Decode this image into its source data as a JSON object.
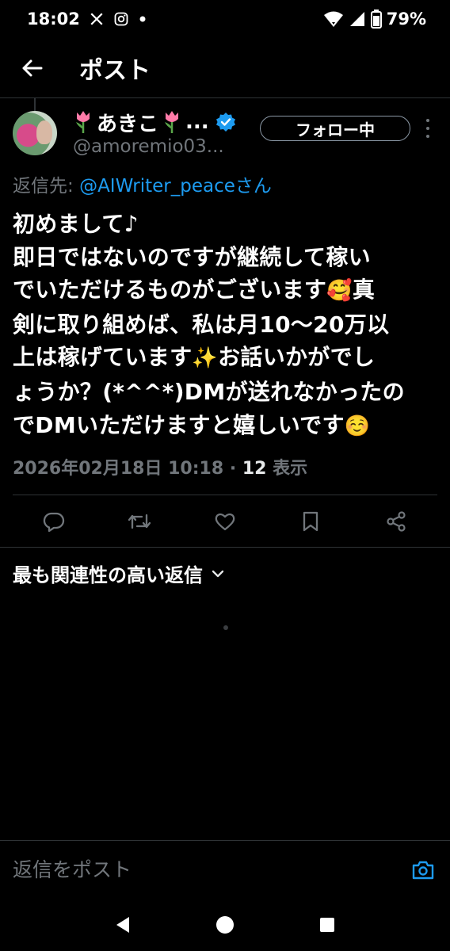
{
  "status_bar": {
    "time": "18:02",
    "battery": "79%",
    "icons": [
      "x-logo-icon",
      "instagram-icon",
      "notification-dot-icon",
      "wifi-icon",
      "signal-icon",
      "battery-icon"
    ]
  },
  "header": {
    "back_icon": "arrow-left-icon",
    "title": "ポスト"
  },
  "post": {
    "author": {
      "display_name": "あきこ",
      "name_suffix": "...",
      "handle": "@amoremio03...",
      "verified": true
    },
    "follow_label": "フォロー中",
    "reply_to_prefix": "返信先: ",
    "reply_to_mention": "@AIWriter_peace",
    "reply_to_suffix": "さん",
    "text_lines": [
      "初めまして♪",
      "即日ではないのですが継続して稼い",
      "でいただけるものがございます",
      "真",
      "剣に取り組めば、私は月10〜20万以",
      "上は稼げています",
      "お話いかがでし",
      "ょうか？(*^^*)DMが送れなかったの",
      "でDMいただけますと嬉しいです"
    ],
    "emojis": [
      "🥰",
      "✨",
      "☺️"
    ],
    "timestamp": "2026年02月18日 10:18",
    "separator": " · ",
    "views_count": "12",
    "views_label": " 表示"
  },
  "actions": [
    {
      "name": "reply-icon"
    },
    {
      "name": "repost-icon"
    },
    {
      "name": "like-icon"
    },
    {
      "name": "bookmark-icon"
    },
    {
      "name": "share-icon"
    }
  ],
  "replies": {
    "sort_label": "最も関連性の高い返信"
  },
  "compose": {
    "placeholder": "返信をポスト"
  },
  "colors": {
    "background": "#000000",
    "text": "#e7e9ea",
    "muted": "#71767b",
    "accent": "#1d9bf0",
    "divider": "#2f3336"
  }
}
